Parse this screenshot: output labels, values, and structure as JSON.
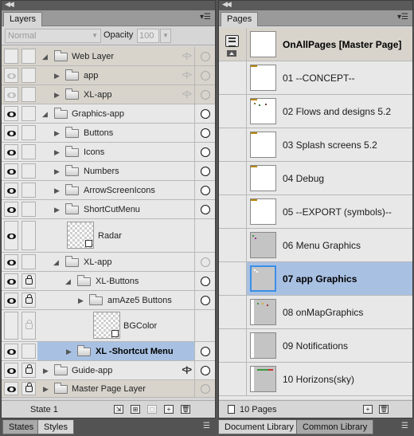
{
  "layers_panel": {
    "tab_label": "Layers",
    "blend_mode": "Normal",
    "opacity_label": "Opacity",
    "opacity_value": "100",
    "state_label": "State 1",
    "rows": [
      {
        "name": "Web Layer"
      },
      {
        "name": "app"
      },
      {
        "name": "XL-app"
      },
      {
        "name": "Graphics-app"
      },
      {
        "name": "Buttons"
      },
      {
        "name": "Icons"
      },
      {
        "name": "Numbers"
      },
      {
        "name": "ArrowScreenIcons"
      },
      {
        "name": "ShortCutMenu"
      },
      {
        "name": "Radar"
      },
      {
        "name": "XL-app"
      },
      {
        "name": "XL-Buttons"
      },
      {
        "name": "amAze5 Buttons"
      },
      {
        "name": "BGColor"
      },
      {
        "name": "XL -Shortcut Menu"
      },
      {
        "name": "Guide-app"
      },
      {
        "name": "Master Page Layer"
      }
    ]
  },
  "pages_panel": {
    "tab_label": "Pages",
    "page_count": "10 Pages",
    "pages": [
      {
        "name": "OnAllPages [Master Page]"
      },
      {
        "name": "01  --CONCEPT--"
      },
      {
        "name": "02  Flows and designs 5.2"
      },
      {
        "name": "03  Splash screens 5.2"
      },
      {
        "name": "04  Debug"
      },
      {
        "name": "05  --EXPORT (symbols)--"
      },
      {
        "name": "06  Menu Graphics"
      },
      {
        "name": "07  app Graphics"
      },
      {
        "name": "08  onMapGraphics"
      },
      {
        "name": "09  Notifications"
      },
      {
        "name": "10  Horizons(sky)"
      }
    ]
  },
  "bottom_tabs": {
    "left": [
      "States",
      "Styles"
    ],
    "right": [
      "Document Library",
      "Common Library"
    ]
  },
  "colors": {
    "selection": "#a8c1e3",
    "panel_bg": "#d6d6d6",
    "chrome": "#535353",
    "thumb_accent": "#3a8ee6"
  }
}
